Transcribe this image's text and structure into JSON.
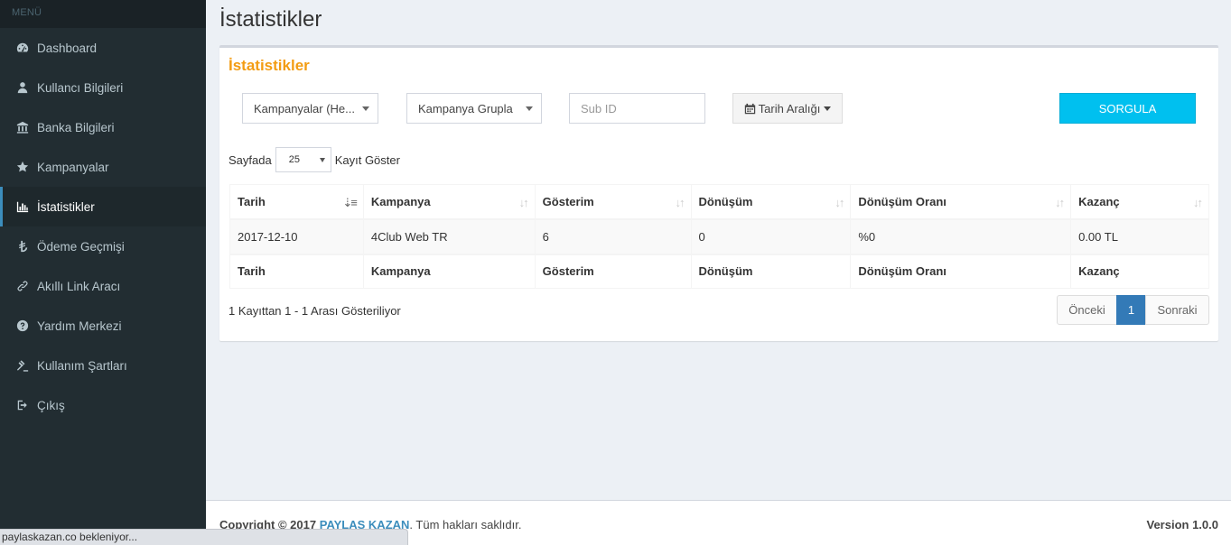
{
  "sidebar": {
    "header": "MENÜ",
    "items": [
      {
        "label": "Dashboard",
        "icon": "dashboard-icon"
      },
      {
        "label": "Kullancı Bilgileri",
        "icon": "user-icon"
      },
      {
        "label": "Banka Bilgileri",
        "icon": "bank-icon"
      },
      {
        "label": "Kampanyalar",
        "icon": "star-icon"
      },
      {
        "label": "İstatistikler",
        "icon": "bar-chart-icon",
        "active": true
      },
      {
        "label": "Ödeme Geçmişi",
        "icon": "lira-icon"
      },
      {
        "label": "Akıllı Link Aracı",
        "icon": "link-icon"
      },
      {
        "label": "Yardım Merkezi",
        "icon": "question-icon"
      },
      {
        "label": "Kullanım Şartları",
        "icon": "gavel-icon"
      },
      {
        "label": "Çıkış",
        "icon": "sign-out-icon"
      }
    ]
  },
  "page": {
    "title": "İstatistikler",
    "box_title": "İstatistikler"
  },
  "filters": {
    "campaigns": "Kampanyalar (He...",
    "group": "Kampanya Grupla",
    "sub_id_placeholder": "Sub ID",
    "date_range": "Tarih Aralığı",
    "query_button": "SORGULA"
  },
  "length": {
    "prefix": "Sayfada",
    "value": "25",
    "suffix": "Kayıt Göster"
  },
  "table": {
    "columns": [
      "Tarih",
      "Kampanya",
      "Gösterim",
      "Dönüşüm",
      "Dönüşüm Oranı",
      "Kazanç"
    ],
    "rows": [
      [
        "2017-12-10",
        "4Club Web TR",
        "6",
        "0",
        "%0",
        "0.00 TL"
      ]
    ]
  },
  "pagination": {
    "info": "1 Kayıttan 1 - 1 Arası Gösteriliyor",
    "prev": "Önceki",
    "current": "1",
    "next": "Sonraki"
  },
  "footer": {
    "copyright": "Copyright © 2017",
    "brand": "PAYLAŞ KAZAN",
    "rights": ". Tüm hakları saklıdır.",
    "version": "Version 1.0.0"
  },
  "status_bar": "paylaskazan.co bekleniyor...",
  "colors": {
    "sidebar_bg": "#222d32",
    "accent": "#3c8dbc",
    "box_title": "#f39c12",
    "query_button": "#00c0ef"
  }
}
